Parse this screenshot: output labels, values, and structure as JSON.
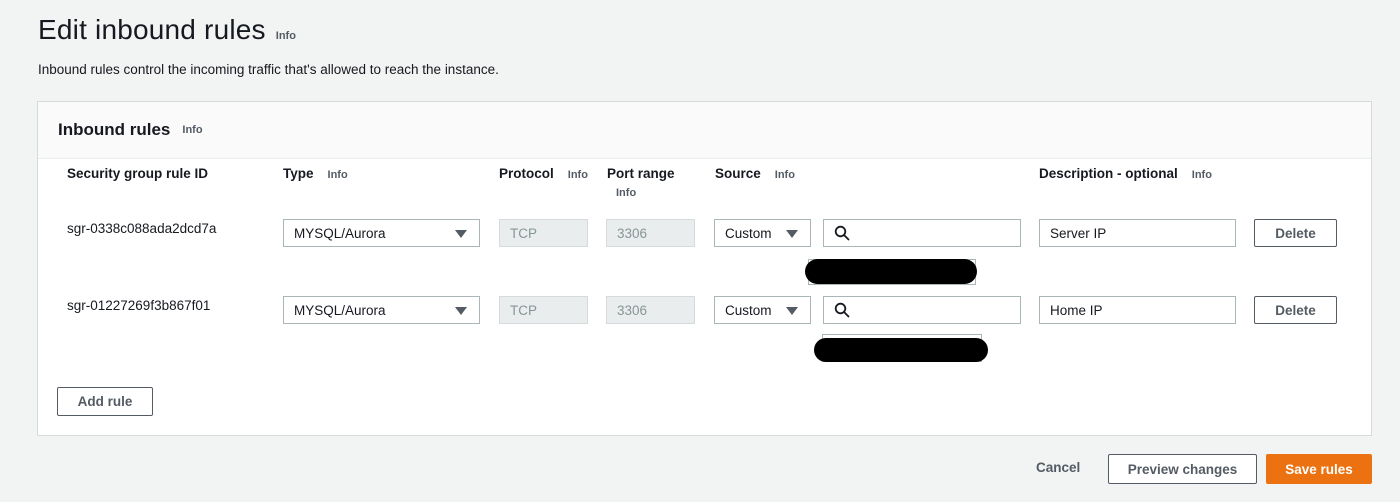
{
  "page": {
    "title": "Edit inbound rules",
    "info": "Info",
    "description": "Inbound rules control the incoming traffic that's allowed to reach the instance."
  },
  "panel": {
    "title": "Inbound rules",
    "info": "Info",
    "columns": {
      "rule_id": "Security group rule ID",
      "type": "Type",
      "protocol": "Protocol",
      "port_range": "Port range",
      "source": "Source",
      "description": "Description - optional",
      "info": "Info"
    },
    "rules": [
      {
        "rule_id": "sgr-0338c088ada2dcd7a",
        "type": "MYSQL/Aurora",
        "protocol": "TCP",
        "port_range": "3306",
        "source": "Custom",
        "source_search": "",
        "description": "Server IP",
        "delete_label": "Delete"
      },
      {
        "rule_id": "sgr-01227269f3b867f01",
        "type": "MYSQL/Aurora",
        "protocol": "TCP",
        "port_range": "3306",
        "source": "Custom",
        "source_search": "",
        "description": "Home IP",
        "delete_label": "Delete"
      }
    ],
    "add_rule_label": "Add rule"
  },
  "footer": {
    "cancel_label": "Cancel",
    "preview_label": "Preview changes",
    "save_label": "Save rules"
  },
  "colors": {
    "primary": "#ec7211",
    "background": "#f2f3f3",
    "border": "#aab7b8",
    "text": "#16191f",
    "muted": "#545b64"
  },
  "icons": {
    "caret": "caret-down-icon",
    "search": "search-icon"
  }
}
